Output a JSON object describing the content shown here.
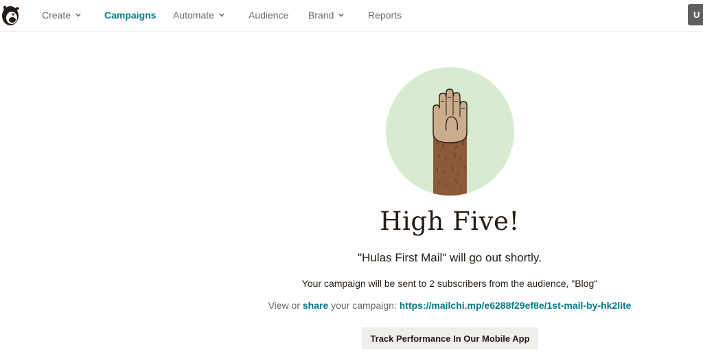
{
  "nav": {
    "items": [
      {
        "label": "Create",
        "dropdown": true,
        "active": false
      },
      {
        "label": "Campaigns",
        "dropdown": false,
        "active": true
      },
      {
        "label": "Automate",
        "dropdown": true,
        "active": false
      },
      {
        "label": "Audience",
        "dropdown": false,
        "active": false
      },
      {
        "label": "Brand",
        "dropdown": true,
        "active": false
      },
      {
        "label": "Reports",
        "dropdown": false,
        "active": false
      }
    ],
    "user_initial": "U"
  },
  "main": {
    "headline": "High Five!",
    "subhead": "\"Hulas First Mail\" will go out shortly.",
    "info": "Your campaign will be sent to 2 subscribers from the audience, \"Blog\"",
    "share": {
      "prefix": "View or",
      "share_link": "share",
      "middle": "your campaign:",
      "url": "https://mailchi.mp/e6288f29ef8e/1st-mail-by-hk2lite"
    },
    "track_button": "Track Performance In Our Mobile App"
  },
  "colors": {
    "accent": "#007c89",
    "circle": "#d8ebd1",
    "text": "#241c15",
    "muted": "#6b6b6b"
  }
}
